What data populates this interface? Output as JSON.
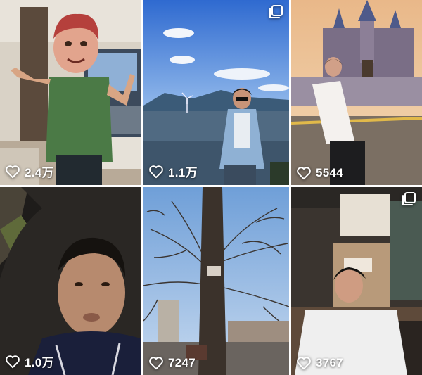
{
  "posts": [
    {
      "likes": "2.4万",
      "icon": "heart-outline-icon",
      "multi_image": false
    },
    {
      "likes": "1.1万",
      "icon": "heart-outline-icon",
      "multi_image": true
    },
    {
      "likes": "5544",
      "icon": "heart-outline-icon",
      "multi_image": false
    },
    {
      "likes": "1.0万",
      "icon": "heart-outline-icon",
      "multi_image": false
    },
    {
      "likes": "7247",
      "icon": "heart-outline-icon",
      "multi_image": false
    },
    {
      "likes": "3767",
      "icon": "heart-outline-icon",
      "multi_image": true
    }
  ],
  "colors": {
    "like_text": "#ffffff",
    "grid_gap": "#ffffff"
  }
}
